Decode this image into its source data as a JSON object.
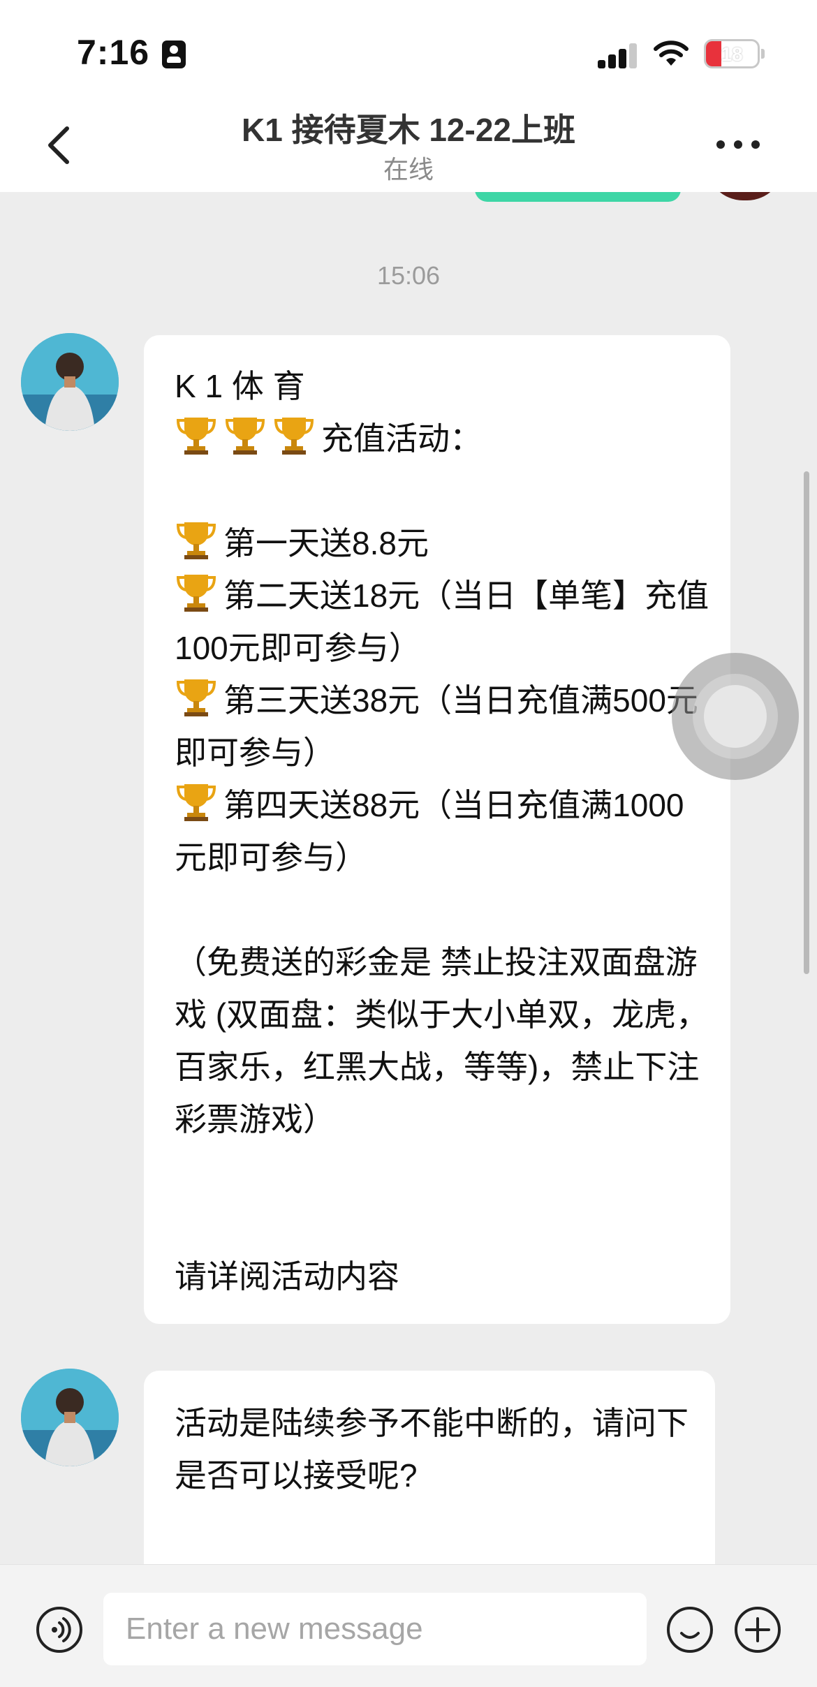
{
  "status_bar": {
    "time": "7:16",
    "battery_level": "18"
  },
  "header": {
    "title": "K1 接待夏木 12-22上班",
    "status": "在线"
  },
  "chat": {
    "timestamp": "15:06",
    "messages": [
      {
        "sender": "agent",
        "lines": [
          {
            "trophies": 0,
            "text": "K 1 体 育"
          },
          {
            "trophies": 3,
            "text": "充值活动："
          },
          {
            "trophies": 0,
            "text": ""
          },
          {
            "trophies": 1,
            "text": "第一天送8.8元"
          },
          {
            "trophies": 1,
            "text": "第二天送18元（当日【单笔】充值100元即可参与）"
          },
          {
            "trophies": 1,
            "text": "第三天送38元（当日充值满500元即可参与）"
          },
          {
            "trophies": 1,
            "text": "第四天送88元（当日充值满1000元即可参与）"
          },
          {
            "trophies": 0,
            "text": ""
          },
          {
            "trophies": 0,
            "text": "（免费送的彩金是 禁止投注双面盘游戏 (双面盘：类似于大小单双，龙虎，百家乐，红黑大战，等等)，禁止下注彩票游戏）"
          },
          {
            "trophies": 0,
            "text": ""
          },
          {
            "trophies": 0,
            "text": ""
          },
          {
            "trophies": 0,
            "text": "请详阅活动内容"
          }
        ]
      },
      {
        "sender": "agent",
        "lines": [
          {
            "trophies": 0,
            "text": "活动是陆续参予不能中断的，请问下是否可以接受呢?"
          }
        ]
      }
    ]
  },
  "input_bar": {
    "placeholder": "Enter a new message"
  },
  "icons": {
    "back": "chevron-left-icon",
    "more": "more-horizontal-icon",
    "voice": "voice-icon",
    "emoji": "emoji-icon",
    "add": "plus-icon",
    "trophy": "trophy-icon"
  },
  "colors": {
    "accent": "#3ed6a6",
    "background": "#ededed",
    "bubble": "#ffffff",
    "battery_low": "#e8323c"
  }
}
